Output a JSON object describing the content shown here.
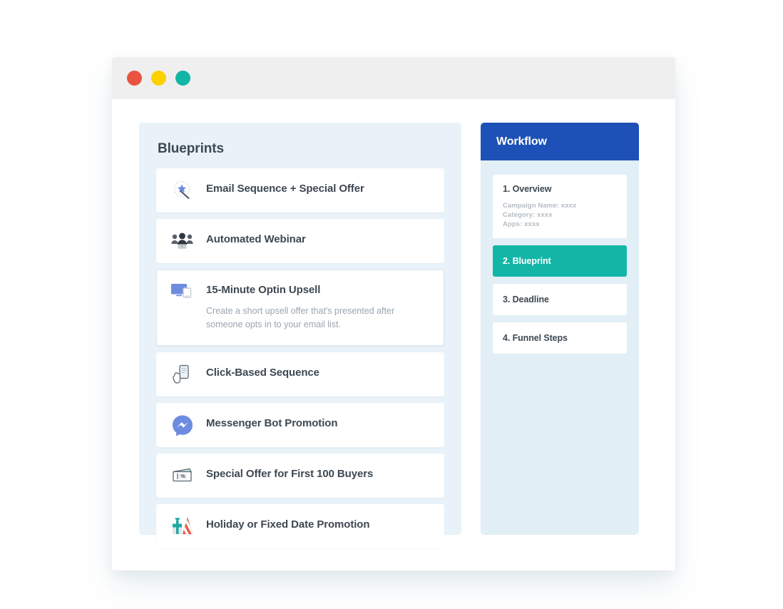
{
  "window": {
    "dots": [
      {
        "name": "close",
        "color": "#e8543f"
      },
      {
        "name": "minimize",
        "color": "#fdd000"
      },
      {
        "name": "maximize",
        "color": "#13b5a6"
      }
    ]
  },
  "blueprints": {
    "title": "Blueprints",
    "items": [
      {
        "label": "Email Sequence + Special Offer",
        "icon": "magic-wand-icon"
      },
      {
        "label": "Automated Webinar",
        "icon": "people-group-icon"
      },
      {
        "label": "15-Minute Optin Upsell",
        "icon": "monitor-devices-icon",
        "description": "Create a short upsell offer that's presented after someone opts in to your email list.",
        "expanded": true
      },
      {
        "label": "Click-Based Sequence",
        "icon": "hand-phone-icon"
      },
      {
        "label": "Messenger Bot Promotion",
        "icon": "messenger-logo-icon"
      },
      {
        "label": "Special Offer for First 100 Buyers",
        "icon": "discount-coupon-icon"
      },
      {
        "label": "Holiday or Fixed Date Promotion",
        "icon": "gift-party-hat-icon"
      }
    ]
  },
  "workflow": {
    "title": "Workflow",
    "header_color": "#1e51b8",
    "active_color": "#13b5a6",
    "steps": [
      {
        "label": "1. Overview",
        "meta": [
          "Campaign Name: xxxx",
          "Category: xxxx",
          "Apps: xxxx"
        ],
        "active": false
      },
      {
        "label": "2. Blueprint",
        "active": true
      },
      {
        "label": "3. Deadline",
        "active": false
      },
      {
        "label": "4. Funnel Steps",
        "active": false
      }
    ]
  }
}
